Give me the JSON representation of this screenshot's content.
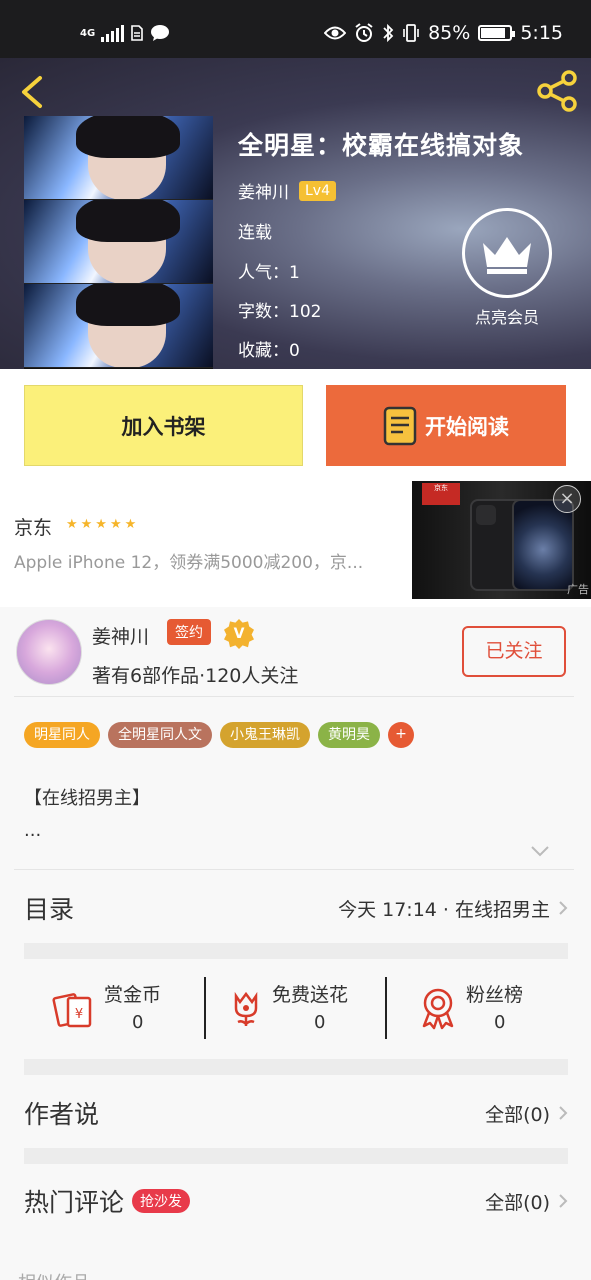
{
  "status_bar": {
    "network": "4G",
    "battery_text": "85%",
    "battery_level": 0.85,
    "time": "5:15"
  },
  "book": {
    "title": "全明星：校霸在线搞对象",
    "author": "姜神川",
    "level": "Lv4",
    "status": "连载",
    "popularity": "人气：1",
    "word_count": "字数：102",
    "favorites": "收藏：0",
    "vip_label": "点亮会员"
  },
  "actions": {
    "add_shelf": "加入书架",
    "start_read": "开始阅读"
  },
  "ad": {
    "name": "京东",
    "stars": "★★★★★",
    "desc": "Apple iPhone 12，领券满5000减200，京...",
    "logo_text": "京东",
    "tag": "广告"
  },
  "author_info": {
    "name": "姜神川",
    "sign_badge": "签约",
    "v_badge": "V",
    "subtitle": "著有6部作品·120人关注",
    "follow_label": "已关注"
  },
  "tags": [
    {
      "label": "明星同人",
      "color": "#f5a623"
    },
    {
      "label": "全明星同人文",
      "color": "#b9735e"
    },
    {
      "label": "小鬼王琳凯",
      "color": "#d4a32e"
    },
    {
      "label": "黄明昊",
      "color": "#8bb347"
    }
  ],
  "tag_more": "+",
  "intro": {
    "line1": "【在线招男主】",
    "line2": "..."
  },
  "catalog": {
    "title": "目录",
    "latest": "今天 17:14 · 在线招男主"
  },
  "rewards": [
    {
      "label": "赏金币",
      "value": "0",
      "icon": "red-envelope-icon"
    },
    {
      "label": "免费送花",
      "value": "0",
      "icon": "flower-icon"
    },
    {
      "label": "粉丝榜",
      "value": "0",
      "icon": "medal-icon"
    }
  ],
  "author_says": {
    "title": "作者说",
    "all": "全部(0)"
  },
  "hot_comments": {
    "title": "热门评论",
    "badge": "抢沙发",
    "all": "全部(0)"
  },
  "similar_title": "相似作品",
  "colors": {
    "accent": "#ec6a3c",
    "shelf_button": "#fbf07a",
    "follow": "#e04f3a",
    "level_badge": "#f5c033"
  }
}
